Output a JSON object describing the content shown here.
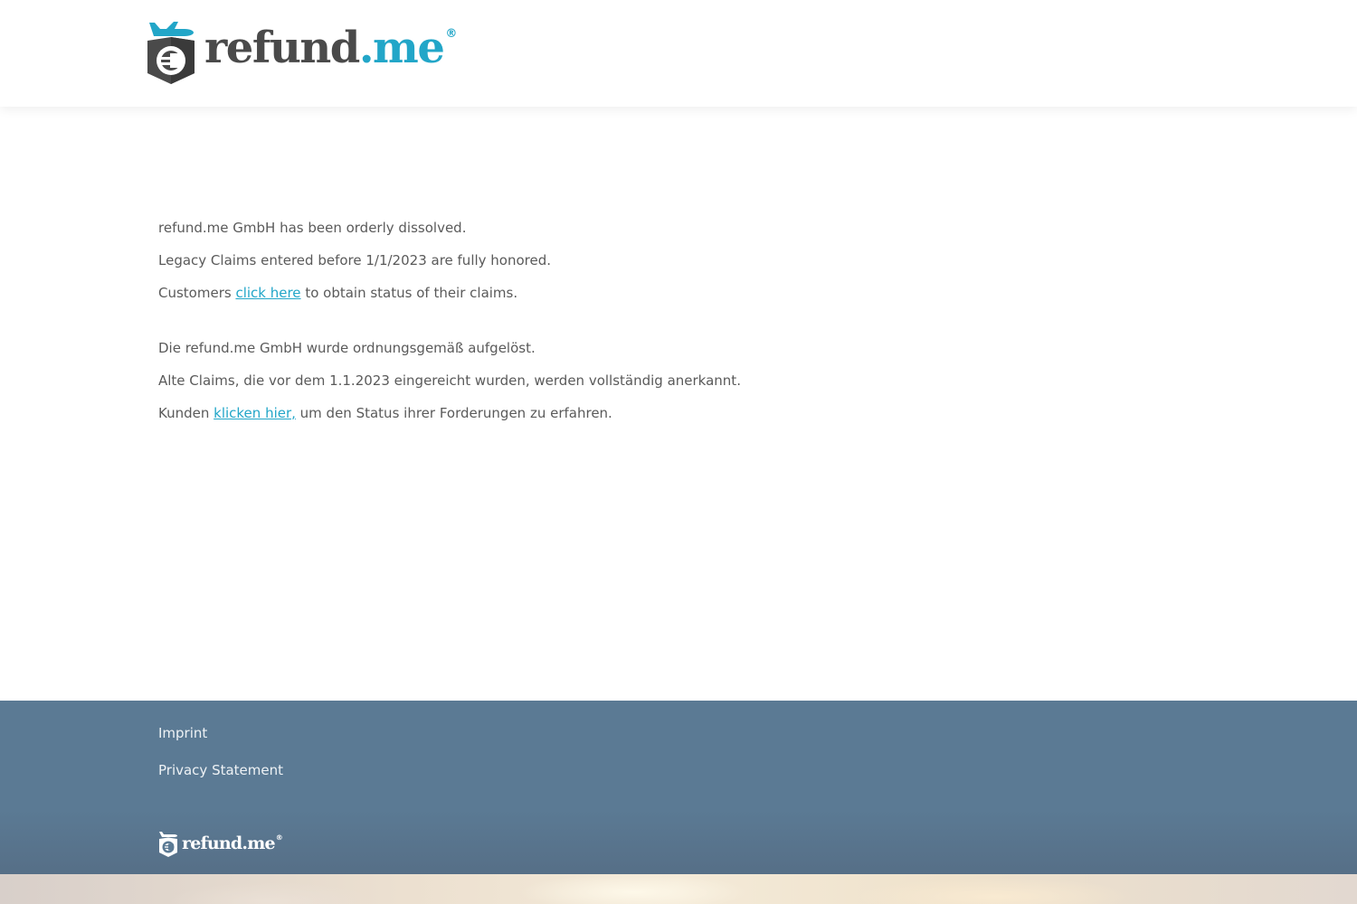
{
  "header": {
    "logo": {
      "wordmark_dark": "refund",
      "wordmark_accent": ".me",
      "registered": "®"
    }
  },
  "notice": {
    "en": {
      "line1": "refund.me GmbH has been orderly dissolved.",
      "line2": "Legacy Claims entered before 1/1/2023 are fully honored.",
      "line3_before": "Customers ",
      "line3_link": "click here",
      "line3_after": " to obtain status of their claims."
    },
    "de": {
      "line1": "Die refund.me GmbH wurde ordnungsgemäß aufgelöst.",
      "line2": "Alte Claims, die vor dem 1.1.2023 eingereicht wurden, werden vollständig anerkannt.",
      "line3_before": "Kunden ",
      "line3_link": "klicken hier,",
      "line3_after": " um den Status ihrer Forderungen zu erfahren."
    }
  },
  "footer": {
    "links": [
      "Imprint",
      "Privacy Statement"
    ],
    "logo": {
      "wordmark": "refund.me",
      "registered": "®"
    }
  },
  "colors": {
    "accent": "#22a6c8",
    "text": "#5a5a5a",
    "wordmark_dark": "#4a4a4a",
    "footer_bg": "#5b7a94"
  },
  "icons": {
    "logo_mark": "euro-shield-plane-icon",
    "footer_logo_mark": "euro-shield-plane-icon"
  }
}
